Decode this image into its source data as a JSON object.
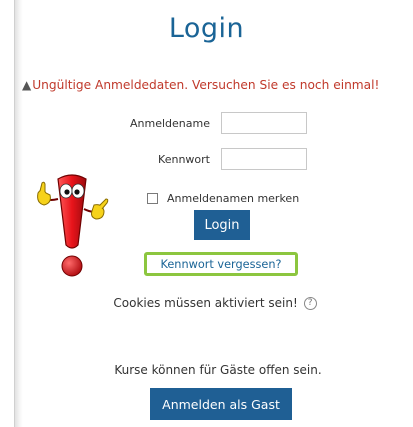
{
  "login": {
    "title": "Login",
    "error_message": "Ungültige Anmeldedaten. Versuchen Sie es noch einmal!",
    "warning_icon": "warning-triangle-icon",
    "username_label": "Anmeldename",
    "username_value": "",
    "password_label": "Kennwort",
    "password_value": "",
    "remember_label": "Anmeldenamen merken",
    "remember_checked": false,
    "login_button": "Login",
    "forgot_link": "Kennwort vergessen?",
    "cookies_notice": "Cookies müssen aktiviert sein!",
    "help_icon": "question-mark-icon",
    "guest_note": "Kurse können für Gäste offen sein.",
    "guest_button": "Anmelden als Gast"
  },
  "mascot": {
    "icon": "exclamation-mark-mascot"
  },
  "colors": {
    "title": "#1a6496",
    "error": "#c0392b",
    "button": "#1f5f94",
    "highlight": "#8cc63f",
    "mascot_red": "#e8141b"
  }
}
